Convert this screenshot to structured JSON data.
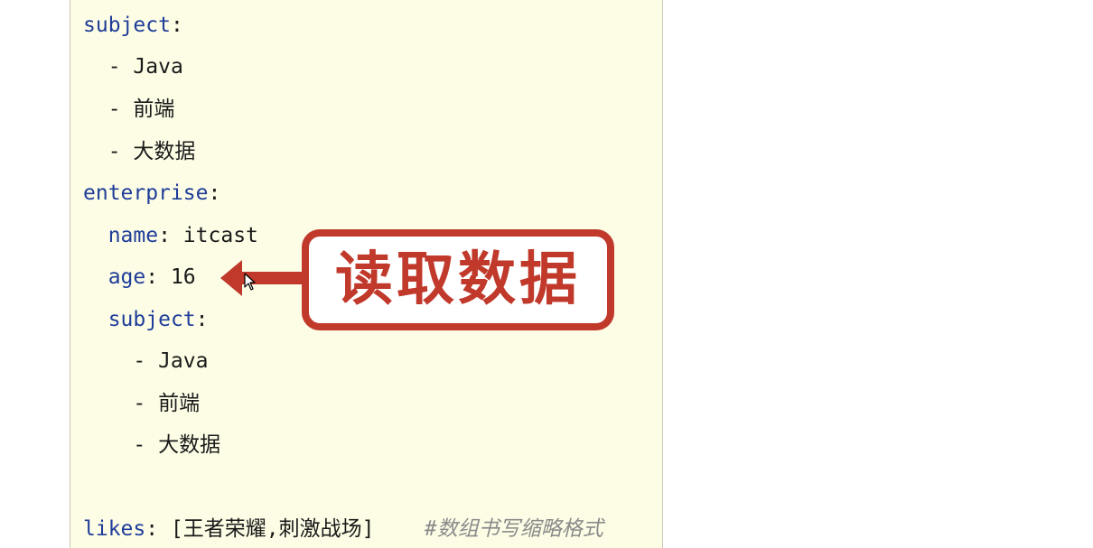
{
  "code": {
    "lines": [
      {
        "indent": "",
        "key": "subject",
        "sep": ":",
        "value": "",
        "comment": ""
      },
      {
        "indent": "  ",
        "key": "",
        "sep": "",
        "value": "- Java",
        "comment": ""
      },
      {
        "indent": "  ",
        "key": "",
        "sep": "",
        "value": "- 前端",
        "comment": ""
      },
      {
        "indent": "  ",
        "key": "",
        "sep": "",
        "value": "- 大数据",
        "comment": ""
      },
      {
        "indent": "",
        "key": "enterprise",
        "sep": ":",
        "value": "",
        "comment": ""
      },
      {
        "indent": "  ",
        "key": "name",
        "sep": ":",
        "value": " itcast",
        "comment": ""
      },
      {
        "indent": "  ",
        "key": "age",
        "sep": ":",
        "value": " 16",
        "comment": ""
      },
      {
        "indent": "  ",
        "key": "subject",
        "sep": ":",
        "value": "",
        "comment": ""
      },
      {
        "indent": "    ",
        "key": "",
        "sep": "",
        "value": "- Java",
        "comment": ""
      },
      {
        "indent": "    ",
        "key": "",
        "sep": "",
        "value": "- 前端",
        "comment": ""
      },
      {
        "indent": "    ",
        "key": "",
        "sep": "",
        "value": "- 大数据",
        "comment": ""
      },
      {
        "indent": "",
        "key": "",
        "sep": "",
        "value": "",
        "comment": ""
      },
      {
        "indent": "",
        "key": "likes",
        "sep": ":",
        "value": " [王者荣耀,刺激战场]",
        "comment": "    #数组书写缩略格式"
      }
    ]
  },
  "callout": {
    "text": "读取数据",
    "color": "#c0392b"
  },
  "colors": {
    "panel_background": "#fdfde6",
    "key": "#1f3d99",
    "comment": "#8a8a8a"
  },
  "icons": {
    "arrow": "left-arrow-icon",
    "cursor": "mouse-pointer-icon"
  }
}
